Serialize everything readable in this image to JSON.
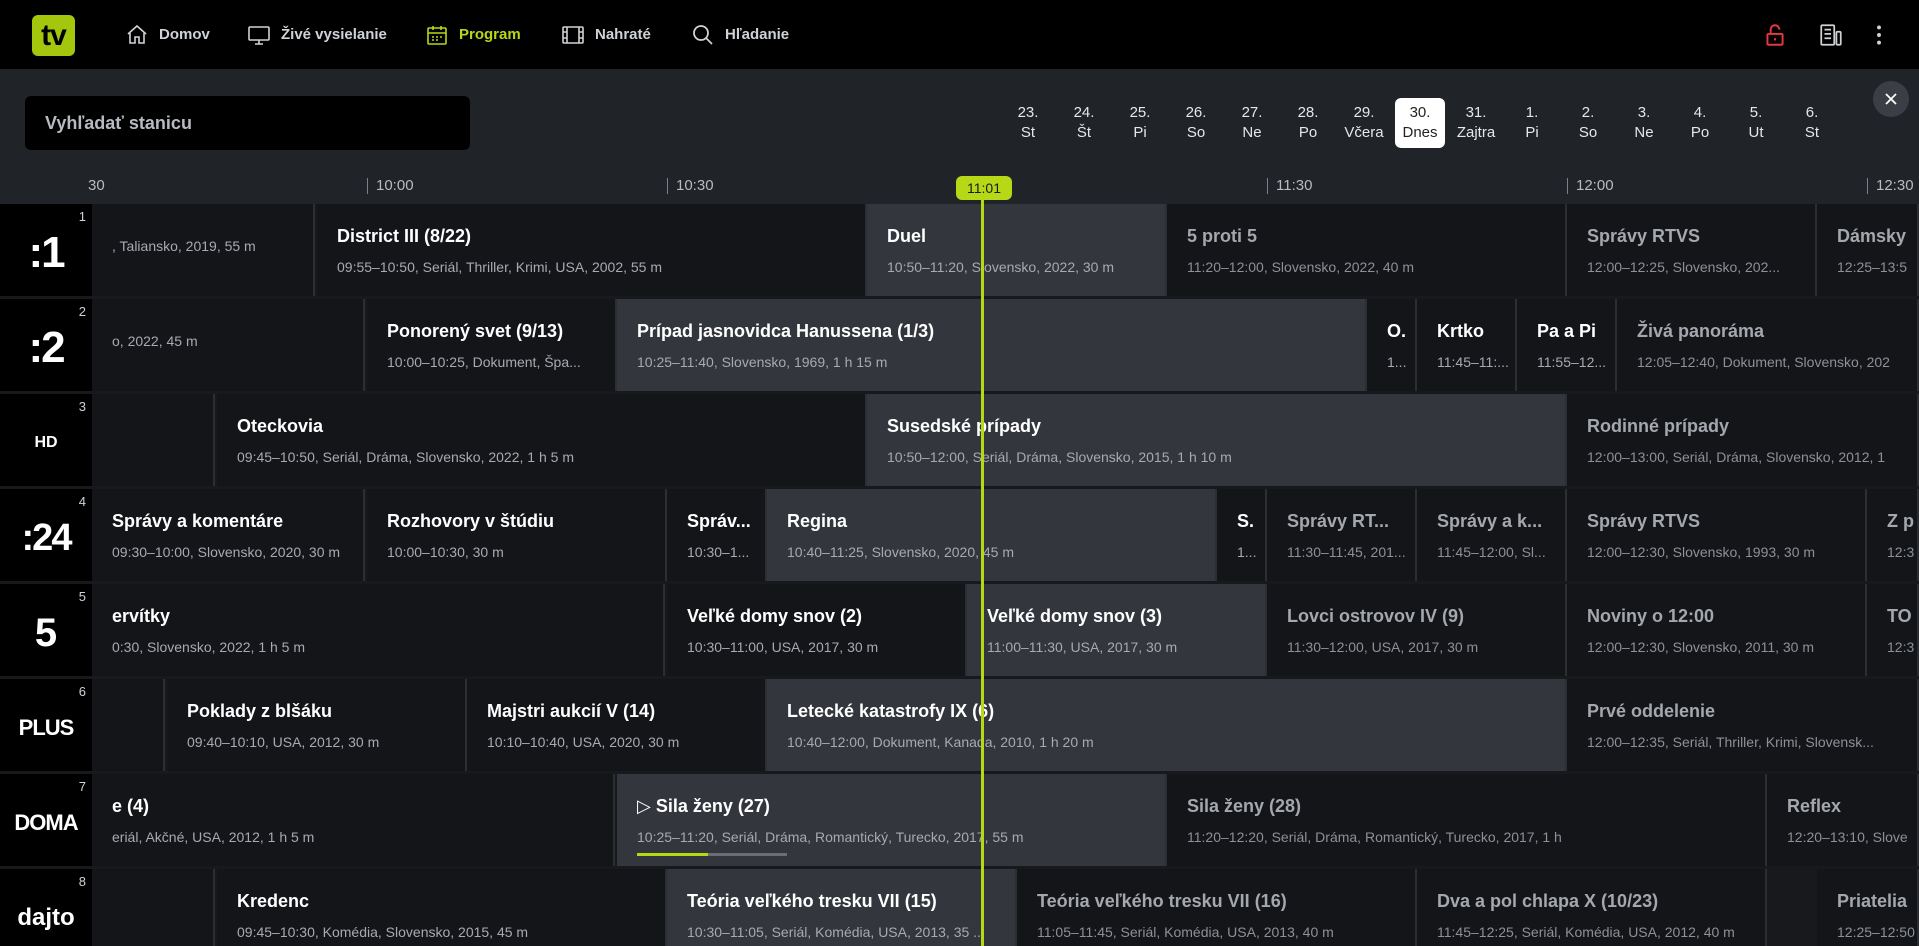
{
  "app": {
    "logo": "tv"
  },
  "nav": [
    {
      "label": "Domov",
      "icon": "home-icon"
    },
    {
      "label": "Živé vysielanie",
      "icon": "monitor-icon"
    },
    {
      "label": "Program",
      "icon": "calendar-icon",
      "active": true
    },
    {
      "label": "Nahraté",
      "icon": "film-icon"
    },
    {
      "label": "Hľadanie",
      "icon": "search-icon"
    }
  ],
  "search": {
    "placeholder": "Vyhľadať stanicu"
  },
  "dates": [
    {
      "day": "23.",
      "name": "St"
    },
    {
      "day": "24.",
      "name": "Št"
    },
    {
      "day": "25.",
      "name": "Pi"
    },
    {
      "day": "26.",
      "name": "So"
    },
    {
      "day": "27.",
      "name": "Ne"
    },
    {
      "day": "28.",
      "name": "Po"
    },
    {
      "day": "29.",
      "name": "Včera"
    },
    {
      "day": "30.",
      "name": "Dnes",
      "active": true
    },
    {
      "day": "31.",
      "name": "Zajtra"
    },
    {
      "day": "1.",
      "name": "Pi"
    },
    {
      "day": "2.",
      "name": "So"
    },
    {
      "day": "3.",
      "name": "Ne"
    },
    {
      "day": "4.",
      "name": "Po"
    },
    {
      "day": "5.",
      "name": "Ut"
    },
    {
      "day": "6.",
      "name": "St"
    }
  ],
  "timeline": {
    "ticks": [
      "30",
      "10:00",
      "10:30",
      "11:30",
      "12:00",
      "12:30"
    ],
    "now": "11:01"
  },
  "channels": [
    {
      "num": "1",
      "logo": ":1",
      "programs": [
        {
          "title": "",
          "meta": ", Taliansko, 2019, 55 m"
        },
        {
          "title": "District III (8/22)",
          "meta": "09:55–10:50, Seriál, Thriller, Krimi, USA, 2002, 55 m"
        },
        {
          "title": "Duel",
          "meta": "10:50–11:20, Slovensko, 2022, 30 m",
          "current": true
        },
        {
          "title": "5 proti 5",
          "meta": "11:20–12:00, Slovensko, 2022, 40 m",
          "future": true
        },
        {
          "title": "Správy RTVS",
          "meta": "12:00–12:25, Slovensko, 202...",
          "future": true
        },
        {
          "title": "Dámsky",
          "meta": "12:25–13:5",
          "future": true
        }
      ]
    },
    {
      "num": "2",
      "logo": ":2",
      "programs": [
        {
          "title": "",
          "meta": "o, 2022, 45 m"
        },
        {
          "title": "Ponorený svet (9/13)",
          "meta": "10:00–10:25, Dokument, Špa..."
        },
        {
          "title": "Prípad jasnovidca Hanussena (1/3)",
          "meta": "10:25–11:40, Slovensko, 1969, 1 h 15 m",
          "current": true
        },
        {
          "title": "O.",
          "meta": "1..."
        },
        {
          "title": "Krtko",
          "meta": "11:45–11:..."
        },
        {
          "title": "Pa a Pi",
          "meta": "11:55–12..."
        },
        {
          "title": "Živá panoráma",
          "meta": "12:05–12:40, Dokument, Slovensko, 202",
          "future": true
        }
      ]
    },
    {
      "num": "3",
      "logo": "HD",
      "programs": [
        {
          "title": "",
          "meta": ""
        },
        {
          "title": "Oteckovia",
          "meta": "09:45–10:50, Seriál, Dráma, Slovensko, 2022, 1 h 5 m"
        },
        {
          "title": "Susedské prípady",
          "meta": "10:50–12:00, Seriál, Dráma, Slovensko, 2015, 1 h 10 m",
          "current": true
        },
        {
          "title": "Rodinné prípady",
          "meta": "12:00–13:00, Seriál, Dráma, Slovensko, 2012, 1",
          "future": true
        }
      ]
    },
    {
      "num": "4",
      "logo": ":24",
      "programs": [
        {
          "title": "Správy a komentáre",
          "meta": "09:30–10:00, Slovensko, 2020, 30 m"
        },
        {
          "title": "Rozhovory v štúdiu",
          "meta": "10:00–10:30, 30 m"
        },
        {
          "title": "Správ...",
          "meta": "10:30–1..."
        },
        {
          "title": "Regina",
          "meta": "10:40–11:25, Slovensko, 2020, 45 m",
          "current": true
        },
        {
          "title": "S.",
          "meta": "1..."
        },
        {
          "title": "Správy RT...",
          "meta": "11:30–11:45, 201...",
          "future": true
        },
        {
          "title": "Správy a k...",
          "meta": "11:45–12:00, Sl...",
          "future": true
        },
        {
          "title": "Správy RTVS",
          "meta": "12:00–12:30, Slovensko, 1993, 30 m",
          "future": true
        },
        {
          "title": "Z p",
          "meta": "12:3",
          "future": true
        }
      ]
    },
    {
      "num": "5",
      "logo": "5",
      "programs": [
        {
          "title": "ervítky",
          "meta": "0:30, Slovensko, 2022, 1 h 5 m"
        },
        {
          "title": "Veľké domy snov (2)",
          "meta": "10:30–11:00, USA, 2017, 30 m"
        },
        {
          "title": "Veľké domy snov (3)",
          "meta": "11:00–11:30, USA, 2017, 30 m",
          "current": true
        },
        {
          "title": "Lovci ostrovov IV (9)",
          "meta": "11:30–12:00, USA, 2017, 30 m",
          "future": true
        },
        {
          "title": "Noviny o 12:00",
          "meta": "12:00–12:30, Slovensko, 2011, 30 m",
          "future": true
        },
        {
          "title": "TO",
          "meta": "12:3",
          "future": true
        }
      ]
    },
    {
      "num": "6",
      "logo": "PLUS",
      "programs": [
        {
          "title": "",
          "meta": ""
        },
        {
          "title": "Poklady z blšáku",
          "meta": "09:40–10:10, USA, 2012, 30 m"
        },
        {
          "title": "Majstri aukcií V (14)",
          "meta": "10:10–10:40, USA, 2020, 30 m"
        },
        {
          "title": "Letecké katastrofy IX (6)",
          "meta": "10:40–12:00, Dokument, Kanada, 2010, 1 h 20 m",
          "current": true
        },
        {
          "title": "Prvé oddelenie",
          "meta": "12:00–12:35, Seriál, Thriller, Krimi, Slovensk...",
          "future": true
        }
      ]
    },
    {
      "num": "7",
      "logo": "DOMA",
      "programs": [
        {
          "title": "e (4)",
          "meta": "eriál, Akčné, USA, 2012, 1 h 5 m"
        },
        {
          "title": "Sila ženy (27)",
          "meta": "10:25–11:20, Seriál, Dráma, Romantický, Turecko, 2017, 55 m",
          "current": true,
          "progress": 0.47
        },
        {
          "title": "Sila ženy (28)",
          "meta": "11:20–12:20, Seriál, Dráma, Romantický, Turecko, 2017, 1 h",
          "future": true
        },
        {
          "title": "Reflex",
          "meta": "12:20–13:10, Slove",
          "future": true
        }
      ]
    },
    {
      "num": "8",
      "logo": "dajto",
      "programs": [
        {
          "title": "",
          "meta": ""
        },
        {
          "title": "Kredenc",
          "meta": "09:45–10:30, Komédia, Slovensko, 2015, 45 m"
        },
        {
          "title": "Teória veľkého tresku VII (15)",
          "meta": "10:30–11:05, Seriál, Komédia, USA, 2013, 35 ...",
          "current": true
        },
        {
          "title": "Teória veľkého tresku VII (16)",
          "meta": "11:05–11:45, Seriál, Komédia, USA, 2013, 40 m",
          "future": true
        },
        {
          "title": "Dva a pol chlapa X (10/23)",
          "meta": "11:45–12:25, Seriál, Komédia, USA, 2012, 40 m",
          "future": true
        },
        {
          "title": "Priatelia",
          "meta": "12:25–12:50",
          "future": true
        }
      ]
    }
  ]
}
